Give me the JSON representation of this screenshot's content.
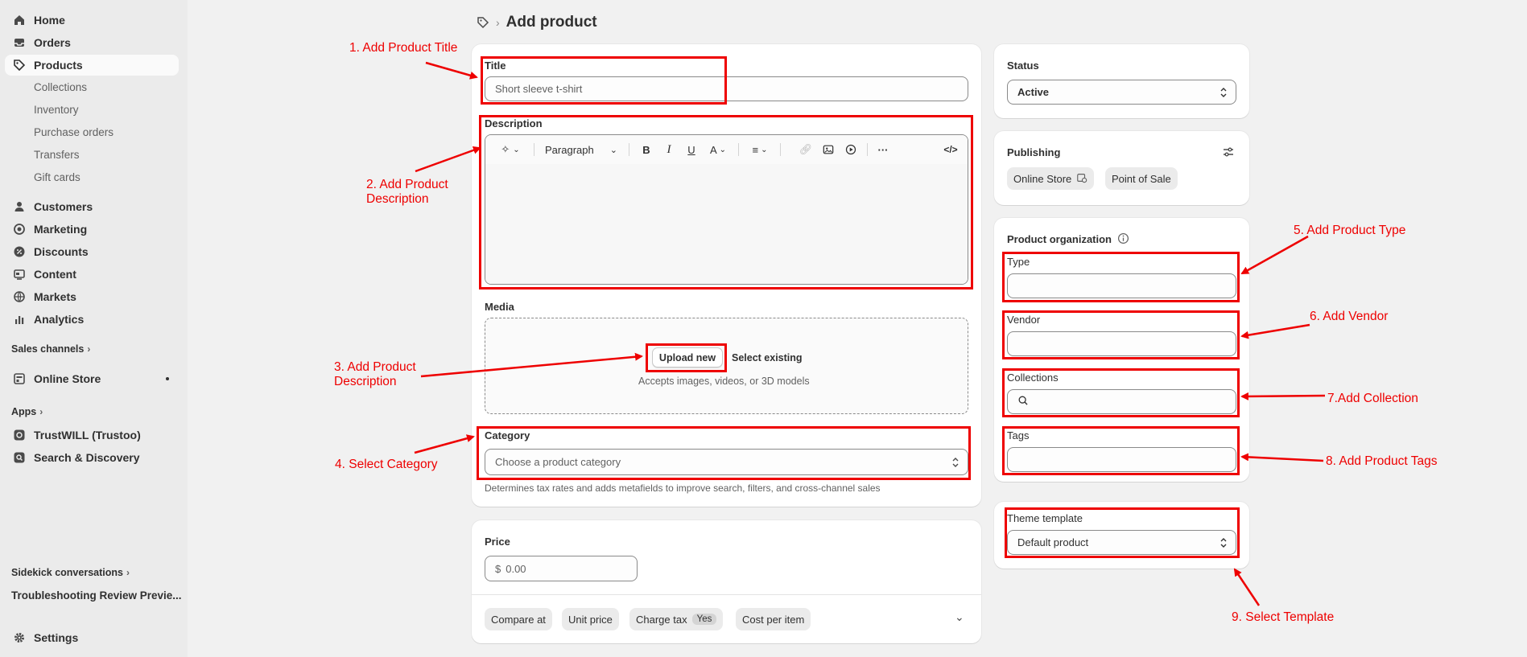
{
  "sidebar": {
    "home": "Home",
    "orders": "Orders",
    "products": "Products",
    "products_sub": [
      "Collections",
      "Inventory",
      "Purchase orders",
      "Transfers",
      "Gift cards"
    ],
    "customers": "Customers",
    "marketing": "Marketing",
    "discounts": "Discounts",
    "content": "Content",
    "markets": "Markets",
    "analytics": "Analytics",
    "sales_channels": "Sales channels",
    "online_store": "Online Store",
    "apps": "Apps",
    "trustwill": "TrustWILL (Trustoo)",
    "search_discovery": "Search & Discovery",
    "sidekick": "Sidekick conversations",
    "troubleshooting": "Troubleshooting Review Previe...",
    "settings": "Settings"
  },
  "header": {
    "title": "Add product",
    "separator": "›"
  },
  "main": {
    "title_label": "Title",
    "title_placeholder": "Short sleeve t-shirt",
    "description_label": "Description",
    "paragraph_label": "Paragraph",
    "media_label": "Media",
    "upload_new": "Upload new",
    "select_existing": "Select existing",
    "media_hint": "Accepts images, videos, or 3D models",
    "category_label": "Category",
    "category_placeholder": "Choose a product category",
    "category_hint": "Determines tax rates and adds metafields to improve search, filters, and cross-channel sales",
    "price_label": "Price",
    "currency_symbol": "$",
    "price_placeholder": "0.00",
    "compare_at": "Compare at",
    "unit_price": "Unit price",
    "charge_tax": "Charge tax",
    "charge_tax_value": "Yes",
    "cost_per_item": "Cost per item"
  },
  "side": {
    "status_label": "Status",
    "status_value": "Active",
    "publishing_label": "Publishing",
    "online_store": "Online Store",
    "point_of_sale": "Point of Sale",
    "org_label": "Product organization",
    "type_label": "Type",
    "vendor_label": "Vendor",
    "collections_label": "Collections",
    "tags_label": "Tags",
    "theme_label": "Theme template",
    "theme_value": "Default product"
  },
  "annotations": {
    "a1": "1. Add Product Title",
    "a2_line1": "2. Add Product",
    "a2_line2": "Description",
    "a3_line1": "3. Add Product",
    "a3_line2": "Description",
    "a4": "4. Select Category",
    "a5": "5. Add Product Type",
    "a6": "6. Add Vendor",
    "a7": "7.Add Collection",
    "a8": "8. Add Product Tags",
    "a9": "9. Select Template"
  },
  "colors": {
    "annotation": "#ee0000",
    "sidebar_bg": "#ebebeb",
    "page_bg": "#f1f1f1"
  }
}
